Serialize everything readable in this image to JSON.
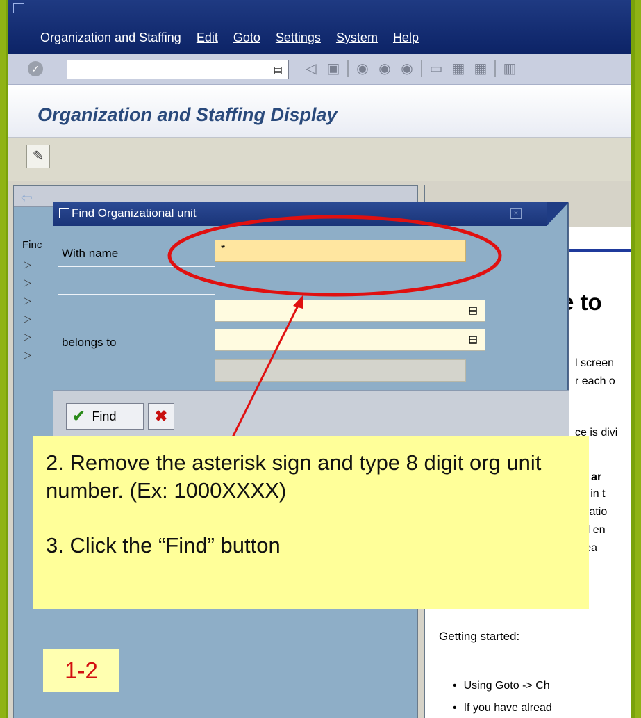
{
  "menu": {
    "items": [
      "Organization and Staffing",
      "Edit",
      "Goto",
      "Settings",
      "System",
      "Help"
    ]
  },
  "toolbar": {
    "command_value": ""
  },
  "screen": {
    "title": "Organization and Staffing Display"
  },
  "left_pane": {
    "find_label": "Finc"
  },
  "dialog": {
    "title": "Find Organizational unit",
    "with_name_label": "With name",
    "with_name_value": "*",
    "belongs_to_label": "belongs to",
    "find_button": "Find"
  },
  "right_pane": {
    "heading": "e to",
    "lines": [
      "l screen",
      "r each o",
      "ce is divi",
      "ch ar",
      "ed in t",
      "nizatio",
      "nal en",
      "area"
    ],
    "getting_started": "Getting started:",
    "bullets": [
      "Using Goto -> Ch",
      "If you have alread"
    ]
  },
  "annotation": {
    "step2": "2. Remove the asterisk sign and type 8 digit org unit number.  (Ex: 1000XXXX)",
    "step3": "3. Click the “Find” button",
    "page": "1-2"
  }
}
